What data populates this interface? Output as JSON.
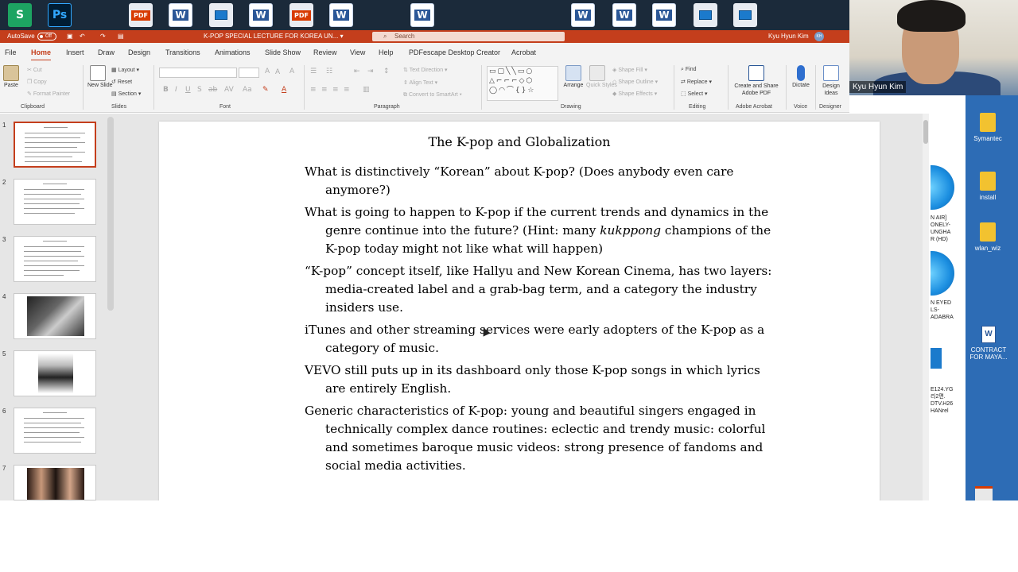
{
  "taskbar": {
    "pdf_label": "PDF",
    "word_letter": "W",
    "ps_label": "Ps"
  },
  "titlebar": {
    "autosave_label": "AutoSave",
    "autosave_state": "Off",
    "doc_title": "K-POP SPECIAL LECTURE FOR KOREA UN... ▾",
    "search_placeholder": "Search",
    "user_name": "Kyu Hyun Kim",
    "user_initials": "KH"
  },
  "ribbon_tabs": [
    "File",
    "Home",
    "Insert",
    "Draw",
    "Design",
    "Transitions",
    "Animations",
    "Slide Show",
    "Review",
    "View",
    "Help",
    "PDFescape Desktop Creator",
    "Acrobat"
  ],
  "ribbon": {
    "clipboard": {
      "paste": "Paste",
      "cut": "Cut",
      "copy": "Copy",
      "format_painter": "Format Painter",
      "group": "Clipboard"
    },
    "slides": {
      "new_slide": "New Slide",
      "layout": "Layout",
      "reset": "Reset",
      "section": "Section",
      "group": "Slides"
    },
    "font": {
      "group": "Font"
    },
    "paragraph": {
      "text_direction": "Text Direction",
      "align_text": "Align Text",
      "convert_smartart": "Convert to SmartArt",
      "group": "Paragraph"
    },
    "drawing": {
      "arrange": "Arrange",
      "quick_styles": "Quick Styles",
      "shape_fill": "Shape Fill",
      "shape_outline": "Shape Outline",
      "shape_effects": "Shape Effects",
      "group": "Drawing"
    },
    "editing": {
      "find": "Find",
      "replace": "Replace",
      "select": "Select",
      "group": "Editing"
    },
    "acrobat": {
      "create_share": "Create and Share Adobe PDF",
      "group": "Adobe Acrobat"
    },
    "voice": {
      "dictate": "Dictate",
      "group": "Voice"
    },
    "designer": {
      "design_ideas": "Design Ideas",
      "group": "Designer"
    }
  },
  "thumbnails": {
    "numbers": [
      "1",
      "2",
      "3",
      "4",
      "5",
      "6",
      "7"
    ],
    "selected": 1
  },
  "slide": {
    "title": "The K-pop and Globalization",
    "bullets": [
      {
        "text": "What is distinctively “Korean” about K-pop?  (Does anybody even care anymore?)"
      },
      {
        "pre": "What is going to happen to K-pop if the current trends and dynamics in the genre continue into the future?  (Hint: many ",
        "italic": "kukppong",
        "post": " champions of the K-pop today might not like what will happen)"
      },
      {
        "text": "“K-pop” concept itself, like Hallyu and New Korean Cinema, has two layers: media-created label and a grab-bag term, and a category the industry insiders use."
      },
      {
        "text": "iTunes and other streaming services were early adopters of the K-pop as a category of music."
      },
      {
        "text": "VEVO still puts up in its dashboard only those K-pop songs in which lyrics are entirely English."
      },
      {
        "text": "Generic characteristics of K-pop: young and beautiful singers engaged in technically complex dance routines: eclectic and trendy music: colorful and sometimes baroque music videos: strong presence of fandoms and social media activities."
      }
    ]
  },
  "webcam": {
    "name": "Kyu Hyun Kim"
  },
  "desktop": {
    "icons": [
      {
        "label": "Symantec"
      },
      {
        "label": "install"
      },
      {
        "label": "wlan_wiz"
      },
      {
        "label": "CONTRACT FOR MAYA..."
      }
    ],
    "partial_labels": [
      "N AIR]",
      "ONELY-",
      "UNGHA",
      "R (HD)",
      "N EYED",
      "LS-",
      "ADABRA",
      "E124.YG",
      "리2편.",
      "DTV.H26",
      "HANrel"
    ]
  },
  "colors": {
    "accent": "#c43e1c",
    "ribbon_bg": "#f3f3f3",
    "canvas_bg": "#e6e6e6",
    "taskbar_bg": "#1b2a3a"
  }
}
